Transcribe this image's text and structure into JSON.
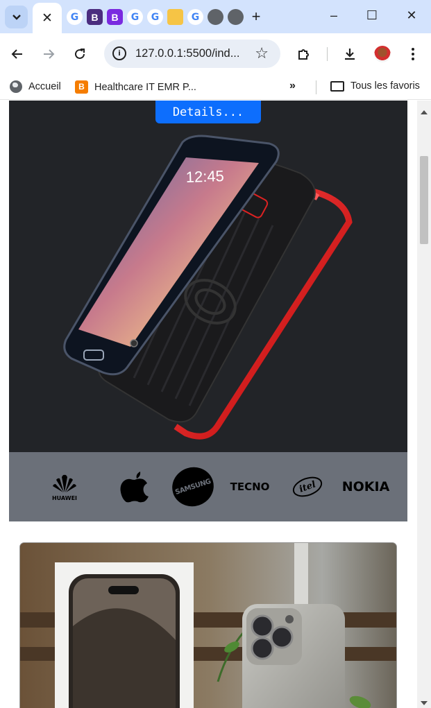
{
  "browser": {
    "active_tab_close": "✕",
    "new_tab": "+",
    "window_controls": {
      "minimize": "–",
      "maximize": "☐",
      "close": "✕"
    },
    "tab_favicons": [
      {
        "icon": "google-icon",
        "label": "G"
      },
      {
        "icon": "bootstrap-icon",
        "label": "B"
      },
      {
        "icon": "bootstrap-icon",
        "label": "B"
      },
      {
        "icon": "google-icon",
        "label": "G"
      },
      {
        "icon": "google-icon",
        "label": "G"
      },
      {
        "icon": "book-icon",
        "label": ""
      },
      {
        "icon": "google-icon",
        "label": "G"
      },
      {
        "icon": "globe-icon",
        "label": ""
      },
      {
        "icon": "globe-icon",
        "label": ""
      }
    ],
    "url": "127.0.0.1:5500/ind...",
    "bookmarks": [
      {
        "label": "Accueil",
        "icon": "globe-icon"
      },
      {
        "label": "Healthcare IT EMR P...",
        "icon": "blogger-icon"
      }
    ],
    "bookmarks_overflow": "»",
    "all_bookmarks": "Tous les favoris"
  },
  "page": {
    "details_button": "Details...",
    "brands": [
      "HUAWEI",
      "Apple",
      "SAMSUNG",
      "TECNO",
      "itel",
      "NOKIA"
    ],
    "colors": {
      "hero_bg": "#222428",
      "brand_bar": "#6b7079",
      "button": "#0d6efd"
    }
  }
}
